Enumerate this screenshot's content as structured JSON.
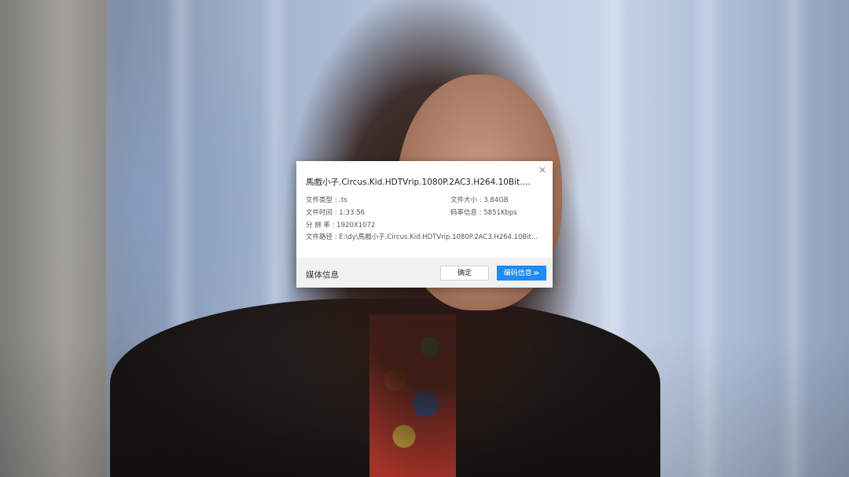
{
  "dialog": {
    "title": "馬戲小子.Circus.Kid.HDTVrip.1080P.2AC3.H264.10Bit.chan...",
    "close_icon": "×",
    "file_type": "文件类型 : .ts",
    "file_size": "文件大小 : 3.84GB",
    "file_duration": "文件时间 : 1:33:56",
    "bitrate": "码率信息 : 5851Kbps",
    "resolution": "分 辨 率 : 1920X1072",
    "file_path": "文件路径 : E:\\dy\\馬戲小子.Circus.Kid.HDTVrip.1080P.2AC3.H264.10Bit...",
    "footer_label": "媒体信息",
    "ok_label": "确定",
    "encode_label": "编码信息",
    "encode_chevron": "≫"
  }
}
